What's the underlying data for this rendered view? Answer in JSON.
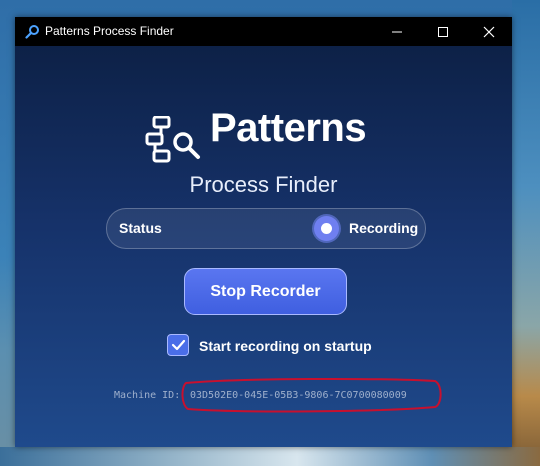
{
  "window": {
    "title": "Patterns Process Finder",
    "icons": [
      "search-icon",
      "minimize-icon",
      "maximize-icon",
      "close-icon"
    ]
  },
  "logo": {
    "title": "Patterns",
    "subtitle": "Process Finder",
    "icon": "process-search-icon"
  },
  "status": {
    "label": "Status",
    "value": "Recording"
  },
  "controls": {
    "stop_label": "Stop Recorder",
    "startup_checkbox_label": "Start recording on startup",
    "startup_checked": true
  },
  "machine": {
    "label": "Machine ID:",
    "id": "03D502E0-045E-05B3-9806-7C0700080009"
  },
  "colors": {
    "accent": "#4a6ee8",
    "background_top": "#0d2147",
    "background_bottom": "#1f4a8c",
    "annotation": "#c8102e"
  }
}
